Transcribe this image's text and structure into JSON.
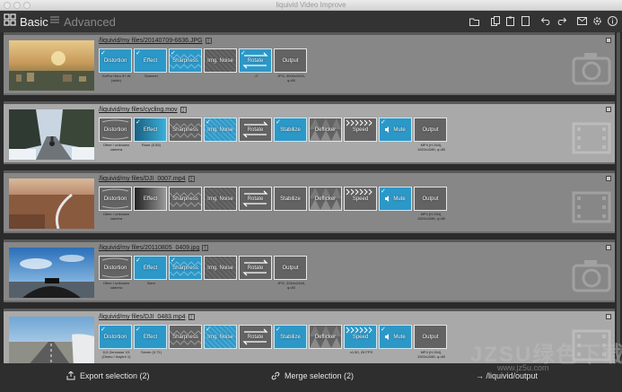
{
  "window": {
    "title": "liquivid Video Improve"
  },
  "toolbar": {
    "basic_label": "Basic",
    "advanced_label": "Advanced",
    "icons": [
      "folder-icon",
      "copy-icon",
      "paste-icon",
      "clipboard-icon",
      "undo-icon",
      "redo-icon",
      "mail-icon",
      "settings-icon",
      "info-icon"
    ]
  },
  "rows": [
    {
      "filename": "/liquivid/my files/20140709-6636.JPG",
      "selected": false,
      "thumb": "aerial-city-sunset",
      "steps": [
        {
          "label": "Distortion",
          "state": "on",
          "checked": true,
          "sub": [
            "GoPro Hero 3+ W",
            "(wide)"
          ]
        },
        {
          "label": "Effect",
          "state": "on",
          "checked": true,
          "sub": [
            "Summer"
          ]
        },
        {
          "label": "Sharpness",
          "state": "on",
          "checked": true,
          "sub": []
        },
        {
          "label": "Img. Noise",
          "state": "pat",
          "checked": false,
          "sub": []
        },
        {
          "label": "Rotate",
          "state": "on",
          "checked": true,
          "sub": [
            "-1°"
          ]
        },
        {
          "label": "Output",
          "state": "off",
          "checked": false,
          "sub": [
            "JPG, 3000x2000,",
            "q=80"
          ]
        }
      ]
    },
    {
      "filename": "/liquivid/my files/cycling.mov",
      "selected": true,
      "thumb": "snowy-road-cyclist",
      "steps": [
        {
          "label": "Distortion",
          "state": "off",
          "checked": false,
          "sub": [
            "Other / unknown",
            "camera"
          ]
        },
        {
          "label": "Effect",
          "state": "gradbox",
          "checked": true,
          "sub": [
            "Rose (0.55)"
          ]
        },
        {
          "label": "Sharpness",
          "state": "pat",
          "checked": false,
          "sub": []
        },
        {
          "label": "Img. Noise",
          "state": "on",
          "checked": true,
          "sub": []
        },
        {
          "label": "Rotate",
          "state": "off",
          "checked": false,
          "sub": []
        },
        {
          "label": "Stabilize",
          "state": "on",
          "checked": true,
          "sub": []
        },
        {
          "label": "Deflicker",
          "state": "pat",
          "checked": false,
          "sub": []
        },
        {
          "label": "Speed",
          "state": "off",
          "checked": false,
          "sub": []
        },
        {
          "label": "Mute",
          "state": "on",
          "checked": true,
          "sub": []
        },
        {
          "label": "Output",
          "state": "off",
          "checked": false,
          "sub": [
            "MP4 (H.264),",
            "1920x1080, q=80"
          ]
        }
      ]
    },
    {
      "filename": "/liquivid/my files/DJI_0007.mp4",
      "selected": false,
      "thumb": "aerial-road-sunset",
      "steps": [
        {
          "label": "Distortion",
          "state": "off",
          "checked": false,
          "sub": [
            "Other / unknown",
            "camera"
          ]
        },
        {
          "label": "Effect",
          "state": "gradbox",
          "checked": false,
          "sub": []
        },
        {
          "label": "Sharpness",
          "state": "pat",
          "checked": false,
          "sub": []
        },
        {
          "label": "Img. Noise",
          "state": "pat",
          "checked": false,
          "sub": []
        },
        {
          "label": "Rotate",
          "state": "off",
          "checked": false,
          "sub": []
        },
        {
          "label": "Stabilize",
          "state": "off",
          "checked": false,
          "sub": []
        },
        {
          "label": "Deflicker",
          "state": "pat",
          "checked": false,
          "sub": []
        },
        {
          "label": "Speed",
          "state": "off",
          "checked": false,
          "sub": []
        },
        {
          "label": "Mute",
          "state": "on",
          "checked": true,
          "sub": []
        },
        {
          "label": "Output",
          "state": "off",
          "checked": false,
          "sub": [
            "MP4 (H.264),",
            "1920x1080, q=80"
          ]
        }
      ]
    },
    {
      "filename": "/liquivid/my files/20110805_0409.jpg",
      "selected": false,
      "thumb": "motorcycle-sky",
      "steps": [
        {
          "label": "Distortion",
          "state": "off",
          "checked": false,
          "sub": [
            "Other / unknown",
            "camera"
          ]
        },
        {
          "label": "Effect",
          "state": "on",
          "checked": true,
          "sub": [
            "Bora"
          ]
        },
        {
          "label": "Sharpness",
          "state": "on",
          "checked": true,
          "sub": []
        },
        {
          "label": "Img. Noise",
          "state": "pat",
          "checked": false,
          "sub": []
        },
        {
          "label": "Rotate",
          "state": "off",
          "checked": false,
          "sub": []
        },
        {
          "label": "Output",
          "state": "off",
          "checked": false,
          "sub": [
            "JPG, 3264x2448,",
            "q=80"
          ]
        }
      ]
    },
    {
      "filename": "/liquivid/my files/DJI_0483.mp4",
      "selected": true,
      "thumb": "highway-car",
      "steps": [
        {
          "label": "Distortion",
          "state": "on",
          "checked": true,
          "sub": [
            "DJI Zenmuse X3",
            "(Osmo / Inspire 1)"
          ]
        },
        {
          "label": "Effect",
          "state": "on",
          "checked": true,
          "sub": [
            "Seven (0.71)"
          ]
        },
        {
          "label": "Sharpness",
          "state": "pat",
          "checked": false,
          "sub": []
        },
        {
          "label": "Img. Noise",
          "state": "on",
          "checked": true,
          "sub": []
        },
        {
          "label": "Rotate",
          "state": "off",
          "checked": false,
          "sub": []
        },
        {
          "label": "Stabilize",
          "state": "on",
          "checked": true,
          "sub": []
        },
        {
          "label": "Deflicker",
          "state": "pat",
          "checked": false,
          "sub": []
        },
        {
          "label": "Speed",
          "state": "on",
          "checked": false,
          "sub": [
            "x1.50, 25 FPS"
          ]
        },
        {
          "label": "Mute",
          "state": "on",
          "checked": true,
          "sub": []
        },
        {
          "label": "Output",
          "state": "off",
          "checked": false,
          "sub": [
            "MP4 (H.264),",
            "1920x1080, q=80"
          ]
        }
      ]
    }
  ],
  "bottom": {
    "export_label": "Export selection (2)",
    "merge_label": "Merge selection (2)",
    "output_label": "→ /liquivid/output"
  },
  "watermark": {
    "text": "JZSU绿色下载",
    "url": "www.jz5u.com"
  }
}
